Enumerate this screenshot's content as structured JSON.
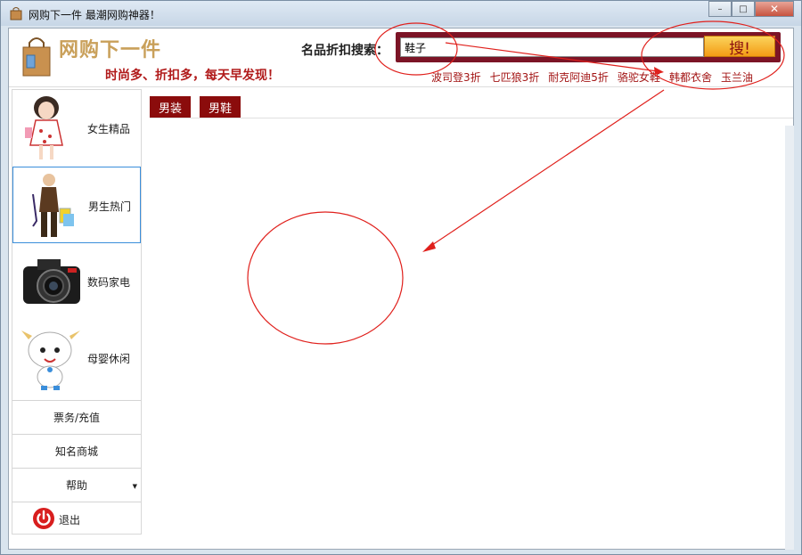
{
  "window": {
    "title": "网购下一件 最潮网购神器！",
    "minimize_label": "–",
    "maximize_label": "□",
    "close_label": "✕"
  },
  "header": {
    "logo_title": "网购下一件",
    "slogan": "时尚多、折扣多，每天早发现！",
    "search_label": "名品折扣搜索：",
    "search_value": "鞋子",
    "search_button": "搜!",
    "hot_links": [
      "波司登3折",
      "七匹狼3折",
      "耐克阿迪5折",
      "骆驼女鞋",
      "韩都衣舍",
      "玉兰油"
    ]
  },
  "sidebar": {
    "categories": [
      {
        "label": "女生精品",
        "icon": "girl-icon"
      },
      {
        "label": "男生热门",
        "icon": "man-icon"
      },
      {
        "label": "数码家电",
        "icon": "camera-icon"
      },
      {
        "label": "母婴休闲",
        "icon": "sheep-icon"
      }
    ],
    "menu": {
      "tickets": "票务/充值",
      "stores": "知名商城",
      "help": "帮助",
      "exit": "退出"
    }
  },
  "content": {
    "tabs": [
      "男装",
      "男鞋"
    ]
  },
  "colors": {
    "accent_red": "#8b0c0c",
    "search_frame": "#7c1426",
    "search_button": "#f39b14",
    "annotation": "#e0201c"
  }
}
